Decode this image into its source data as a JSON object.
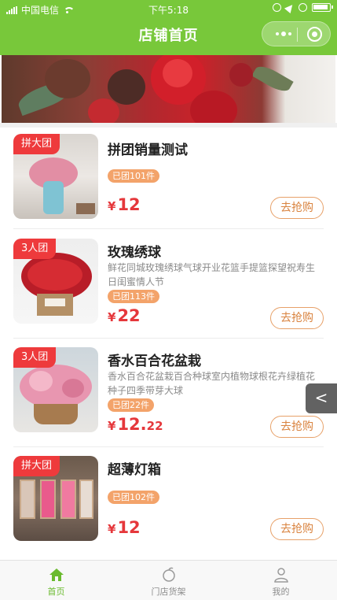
{
  "status_bar": {
    "carrier": "中国电信",
    "time": "下午5:18"
  },
  "nav": {
    "title": "店铺首页"
  },
  "products": [
    {
      "tag": "拼大团",
      "title": "拼团销量测试",
      "desc": "",
      "joined": "已团101件",
      "yen": "¥",
      "price_int": "12",
      "price_dec": "",
      "buy_label": "去抢购"
    },
    {
      "tag": "3人团",
      "title": "玫瑰绣球",
      "desc": "鲜花同城玫瑰绣球气球开业花篮手提篮探望祝寿生日闺蜜情人节",
      "joined": "已团113件",
      "yen": "¥",
      "price_int": "22",
      "price_dec": "",
      "buy_label": "去抢购"
    },
    {
      "tag": "3人团",
      "title": "香水百合花盆栽",
      "desc": "香水百合花盆栽百合种球室内植物球根花卉绿植花种子四季带芽大球",
      "joined": "已团22件",
      "yen": "¥",
      "price_int": "12.",
      "price_dec": "22",
      "buy_label": "去抢购"
    },
    {
      "tag": "拼大团",
      "title": "超薄灯箱",
      "desc": "",
      "joined": "已团102件",
      "yen": "¥",
      "price_int": "12",
      "price_dec": "",
      "buy_label": "去抢购"
    }
  ],
  "float_back": {
    "icon": "chevron-left-icon",
    "glyph": "<"
  },
  "tabbar": {
    "items": [
      {
        "label": "首页",
        "icon": "home-icon",
        "active": true
      },
      {
        "label": "门店货架",
        "icon": "shelf-icon",
        "active": false
      },
      {
        "label": "我的",
        "icon": "user-icon",
        "active": false
      }
    ]
  },
  "colors": {
    "primary": "#78c83a",
    "price": "#e5373b",
    "tag": "#ee3a3c",
    "joined": "#f3a36a",
    "buy_border": "#e7a169"
  }
}
